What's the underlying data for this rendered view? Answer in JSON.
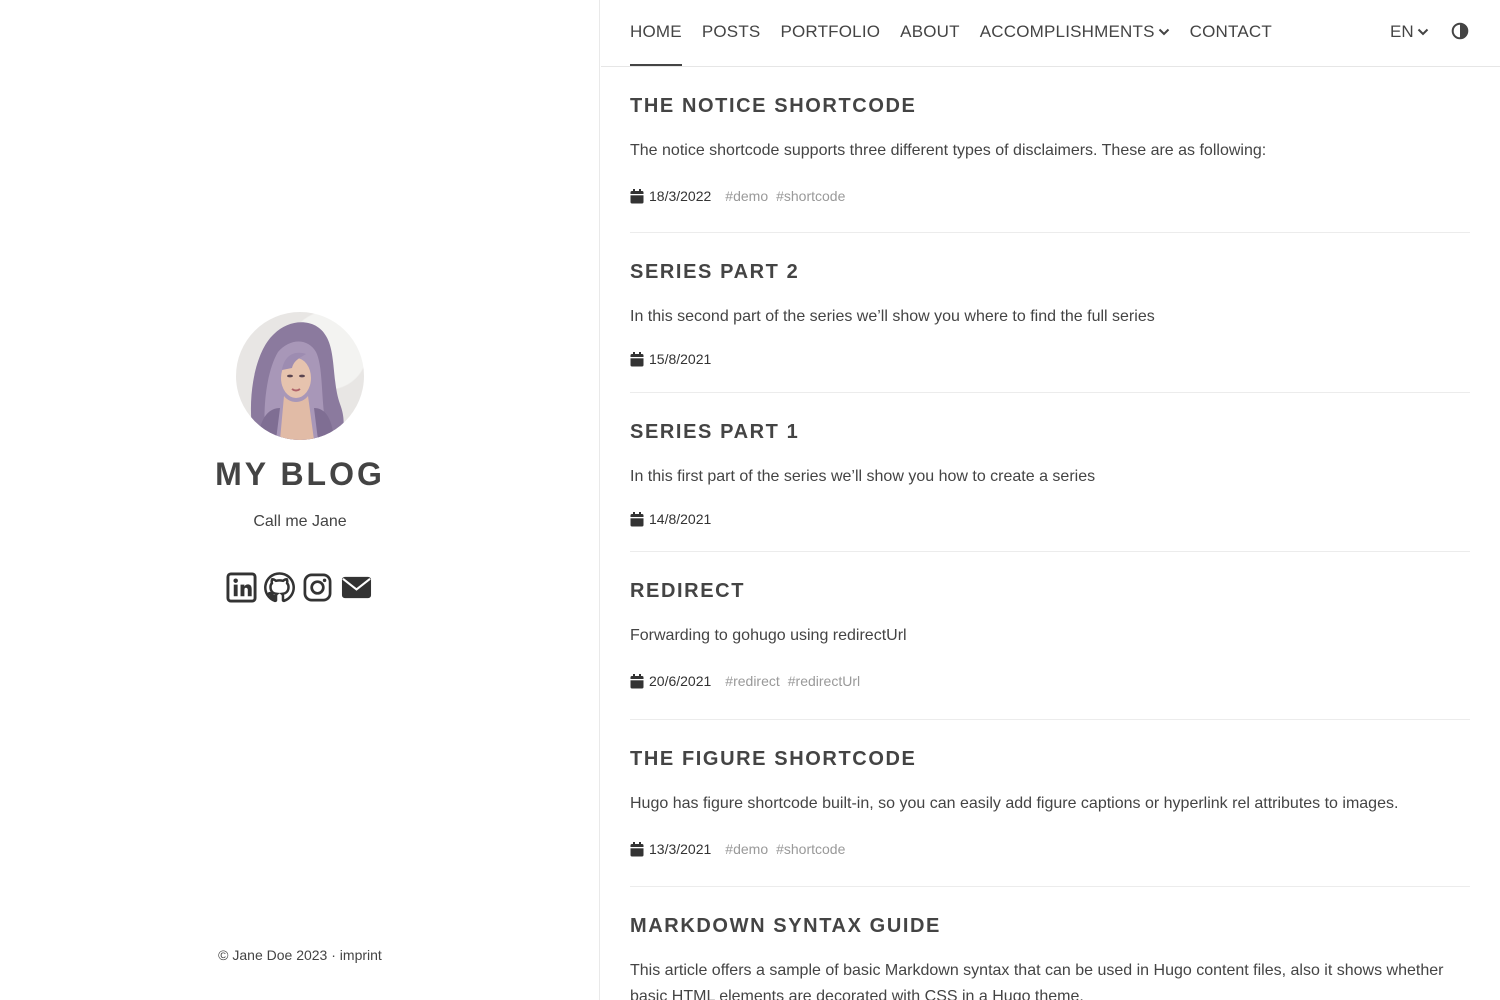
{
  "sidebar": {
    "title": "MY BLOG",
    "subtitle": "Call me Jane",
    "social": [
      "linkedin-icon",
      "github-icon",
      "instagram-icon",
      "email-icon"
    ],
    "footer": {
      "copyright": "© Jane Doe 2023 · ",
      "imprint": "imprint"
    }
  },
  "nav": {
    "items": [
      "HOME",
      "POSTS",
      "PORTFOLIO",
      "ABOUT",
      "ACCOMPLISHMENTS",
      "CONTACT"
    ],
    "active": "HOME",
    "language": "EN"
  },
  "posts": [
    {
      "title": "THE NOTICE SHORTCODE",
      "summary": "The notice shortcode supports three different types of disclaimers. These are as following:",
      "date": "18/3/2022",
      "tags": [
        "#demo",
        "#shortcode"
      ]
    },
    {
      "title": "SERIES PART 2",
      "summary": "In this second part of the series we’ll show you where to find the full series",
      "date": "15/8/2021",
      "tags": []
    },
    {
      "title": "SERIES PART 1",
      "summary": "In this first part of the series we’ll show you how to create a series",
      "date": "14/8/2021",
      "tags": []
    },
    {
      "title": "REDIRECT",
      "summary": "Forwarding to gohugo using redirectUrl",
      "date": "20/6/2021",
      "tags": [
        "#redirect",
        "#redirectUrl"
      ]
    },
    {
      "title": "THE FIGURE SHORTCODE",
      "summary": "Hugo has figure shortcode built-in, so you can easily add figure captions or hyperlink rel attributes to images.",
      "date": "13/3/2021",
      "tags": [
        "#demo",
        "#shortcode"
      ]
    },
    {
      "title": "MARKDOWN SYNTAX GUIDE",
      "summary": "This article offers a sample of basic Markdown syntax that can be used in Hugo content files, also it shows whether basic HTML elements are decorated with CSS in a Hugo theme.",
      "date": "",
      "tags": []
    }
  ],
  "colors": {
    "text": "#444444",
    "tag": "#999999",
    "border": "#e9e9e9"
  }
}
